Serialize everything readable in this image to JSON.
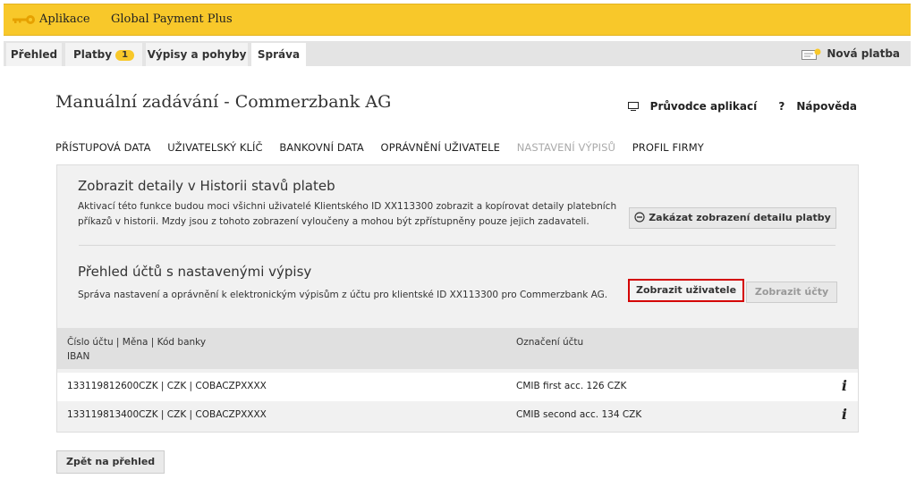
{
  "topbar": {
    "app_label": "Aplikace",
    "product": "Global Payment Plus"
  },
  "tabs": [
    {
      "label": "Přehled"
    },
    {
      "label": "Platby",
      "badge": "1"
    },
    {
      "label": "Výpisy a pohyby"
    },
    {
      "label": "Správa",
      "active": true
    }
  ],
  "new_payment": "Nová platba",
  "page_title": "Manuální zadávání - Commerzbank AG",
  "helpers": {
    "guide": "Průvodce aplikací",
    "help": "Nápověda"
  },
  "subnav": [
    "PŘÍSTUPOVÁ DATA",
    "UŽIVATELSKÝ KLÍČ",
    "BANKOVNÍ DATA",
    "OPRÁVNĚNÍ UŽIVATELE",
    "NASTAVENÍ VÝPISŮ",
    "PROFIL FIRMY"
  ],
  "subnav_active": "NASTAVENÍ VÝPISŮ",
  "section1": {
    "title": "Zobrazit detaily v Historii stavů plateb",
    "text_line1": "Aktivací této funkce budou moci všichni uživatelé Klientského ID XX113300 zobrazit a kopírovat detaily platebních",
    "text_line2": "příkazů v historii. Mzdy jsou z tohoto zobrazení vyloučeny a mohou být zpřístupněny pouze jejich zadavateli.",
    "button": "Zakázat zobrazení detailu platby"
  },
  "section2": {
    "title": "Přehled účtů s nastavenými výpisy",
    "text": "Správa nastavení a oprávnění k elektronickým výpisům z účtu pro klientské ID XX113300 pro Commerzbank AG.",
    "btn_users": "Zobrazit uživatele",
    "btn_accounts": "Zobrazit účty"
  },
  "table": {
    "col1_line1": "Číslo účtu | Měna | Kód banky",
    "col1_line2": "IBAN",
    "col2": "Označení účtu",
    "rows": [
      {
        "account": "133119812600CZK | CZK | COBACZPXXXX",
        "name": "CMIB first acc. 126 CZK",
        "info": "i"
      },
      {
        "account": "133119813400CZK | CZK | COBACZPXXXX",
        "name": "CMIB second acc. 134 CZK",
        "info": "i"
      }
    ]
  },
  "back_button": "Zpět na přehled",
  "colors": {
    "brand_yellow": "#f8c82a",
    "highlight_red": "#d40000"
  }
}
